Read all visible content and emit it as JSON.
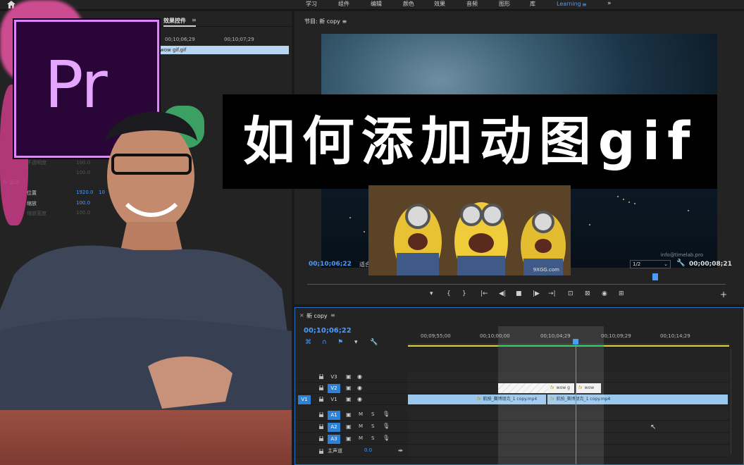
{
  "workspace": {
    "tabs": [
      "学习",
      "组件",
      "编辑",
      "颜色",
      "效果",
      "音频",
      "图形",
      "库",
      "Learning"
    ],
    "active_tab": "Learning",
    "more": "»"
  },
  "effect_controls": {
    "title": "效果控件",
    "menu": "≡",
    "tc_start": "00;10;06;29",
    "tc_end": "00;10;07;29",
    "clip_name": "wow gif.gif",
    "rows": {
      "opacity_label": "不透明度",
      "opacity_value": "100.0",
      "opacity2_value": "100.0",
      "motion": "运动",
      "position_label": "位置",
      "position_value": "1920.0",
      "position_value_y": "10",
      "scale_label": "缩放",
      "scale_value": "100.0",
      "scale_width_label": "缩放宽度",
      "scale_width_value": "100.0"
    }
  },
  "program_monitor": {
    "title": "节目: 新 copy",
    "menu": "≡",
    "timecode": "00;10;06;22",
    "fit": "适合",
    "resolution": "1/2",
    "duration": "00;00;08;21",
    "watermark": "info@timelab.pro",
    "transport": [
      "▾",
      "{",
      "}",
      "|←",
      "◀|",
      "■",
      "|▶",
      "→|",
      "⊡",
      "⊠",
      "◉",
      "⊞"
    ],
    "add": "+"
  },
  "timeline": {
    "title": "新 copy",
    "close": "×",
    "menu": "≡",
    "timecode": "00;10;06;22",
    "ruler": [
      "00;09;55;00",
      "00;10;00;00",
      "00;10;04;29",
      "00;10;09;29",
      "00;10;14;29"
    ],
    "tracks": {
      "v3": "V3",
      "v2": "V2",
      "v1": "V1",
      "a1": "A1",
      "a2": "A2",
      "a3": "A3",
      "src_v1": "V1",
      "m": "M",
      "s": "S",
      "master": "主声道",
      "master_val": "0.0"
    },
    "clips": {
      "v1_a": "航拍_赛博朋克_1 copy.mp4",
      "v1_b": "航拍_赛博朋克_1 copy.mp4",
      "v2_a": "wow g",
      "v2_b": "wow"
    }
  },
  "overlay": {
    "title": "如何添加动图gif",
    "logo": "Pr",
    "gif_watermark": "9XGG.com"
  },
  "colors": {
    "accent": "#4a9bff",
    "panel": "#232323",
    "clip_video": "#9ac7ee",
    "track_blue": "#2d82d8",
    "logo_bg": "#2a0537",
    "logo_border": "#e184ff"
  }
}
